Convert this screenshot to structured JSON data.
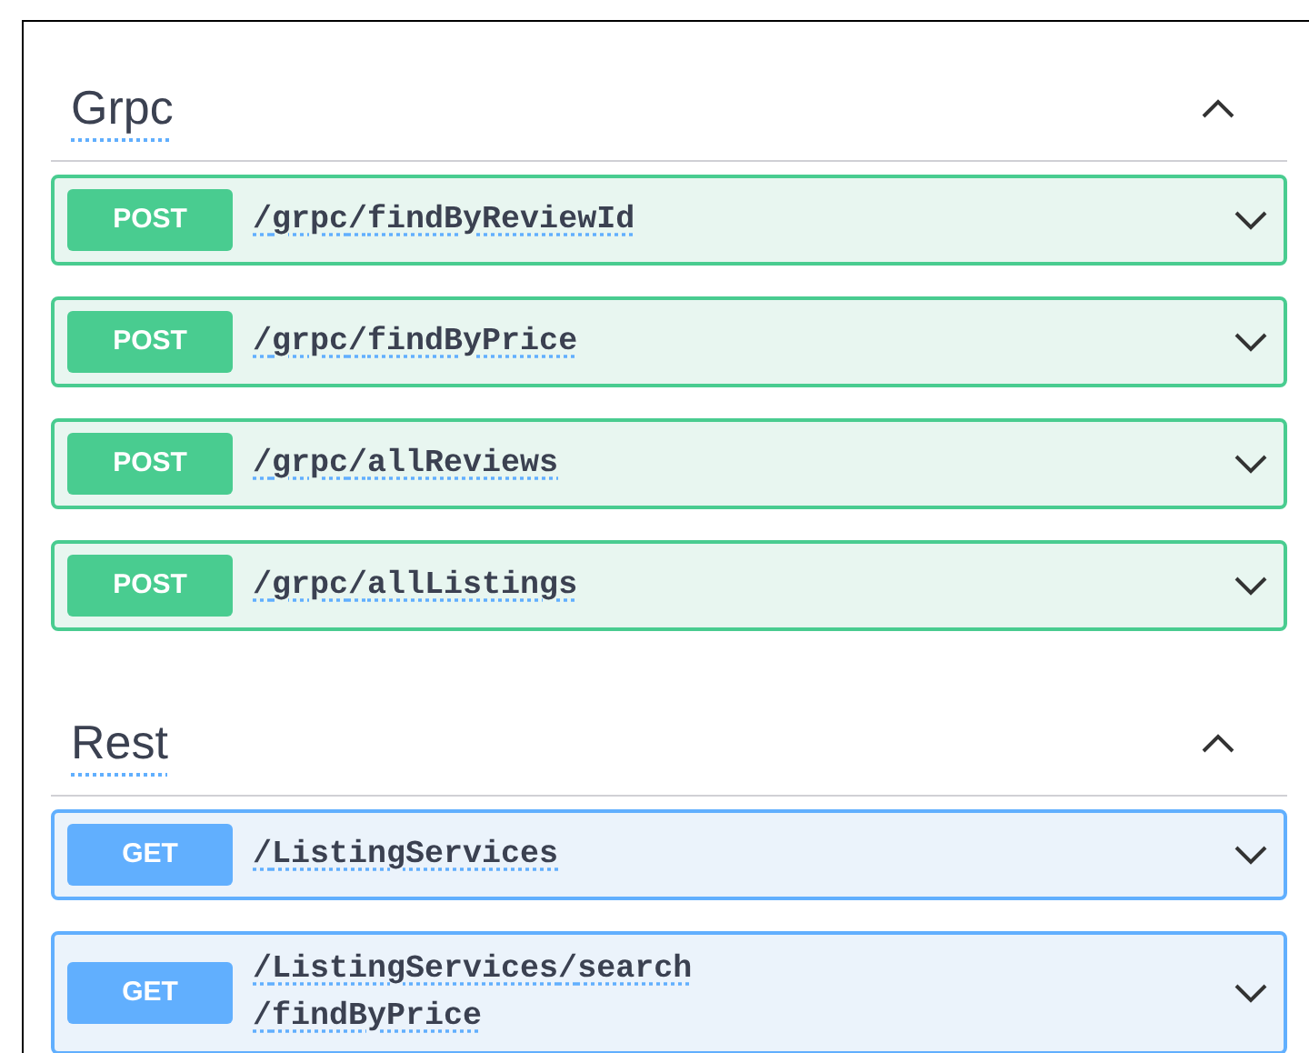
{
  "sections": [
    {
      "title": "Grpc",
      "expanded": true,
      "operations": [
        {
          "kind": "post",
          "method": "POST",
          "path": "/grpc/findByReviewId",
          "expanded": false
        },
        {
          "kind": "post",
          "method": "POST",
          "path": "/grpc/findByPrice",
          "expanded": false
        },
        {
          "kind": "post",
          "method": "POST",
          "path": "/grpc/allReviews",
          "expanded": false
        },
        {
          "kind": "post",
          "method": "POST",
          "path": "/grpc/allListings",
          "expanded": false
        }
      ]
    },
    {
      "title": "Rest",
      "expanded": true,
      "operations": [
        {
          "kind": "get",
          "method": "GET",
          "path": "/ListingServices",
          "expanded": false
        },
        {
          "kind": "get",
          "method": "GET",
          "path": "/ListingServices/search/findByPrice",
          "expanded": false
        }
      ]
    }
  ]
}
